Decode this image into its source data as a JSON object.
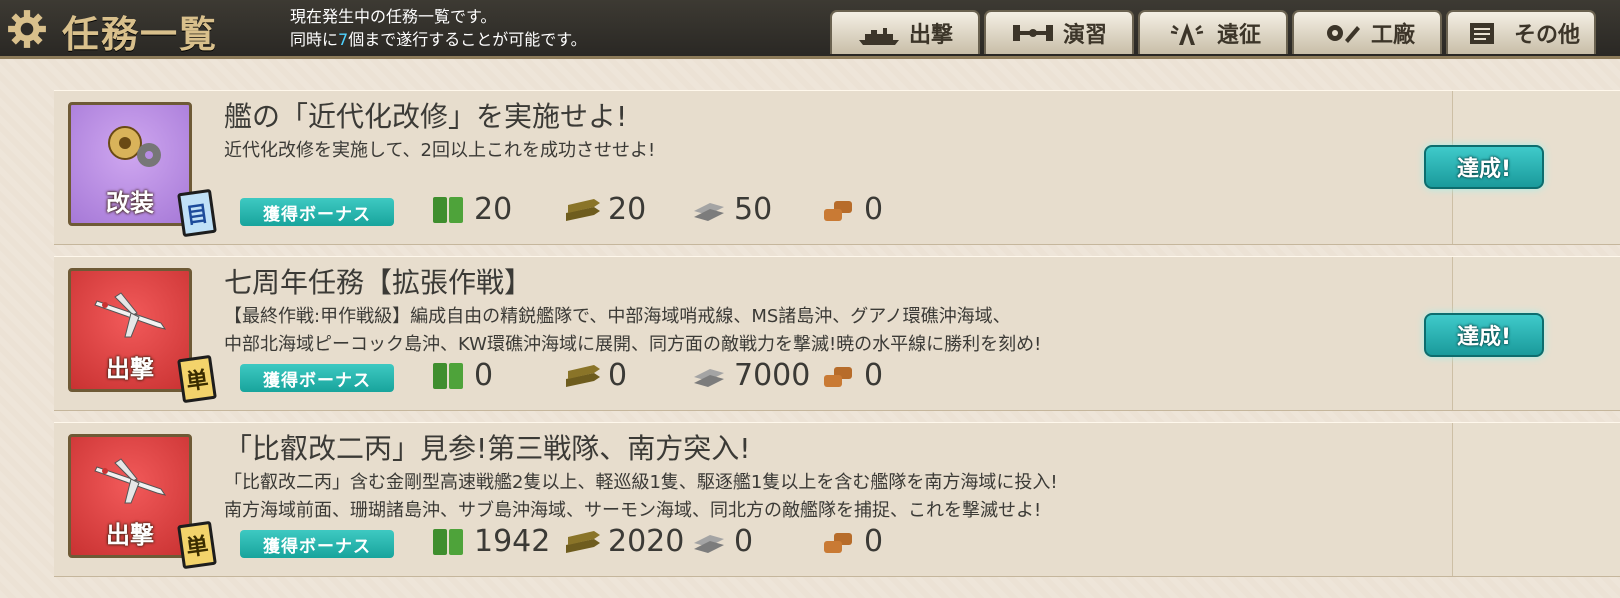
{
  "header": {
    "title": "任務一覧",
    "subtitle_line1": "現在発生中の任務一覧です。",
    "subtitle_line2_pre": "同時に",
    "subtitle_line2_num": "7",
    "subtitle_line2_post": "個まで遂行することが可能です。",
    "icon": "gear-icon"
  },
  "tabs": [
    {
      "label": "出撃",
      "icon": "battleship-silhouette-icon"
    },
    {
      "label": "演習",
      "icon": "dumbbell-icon"
    },
    {
      "label": "遠征",
      "icon": "radio-tower-icon"
    },
    {
      "label": "工廠",
      "icon": "wrench-gear-icon"
    },
    {
      "label": "その他",
      "icon": "notebook-icon"
    }
  ],
  "bonus_label": "獲得ボーナス",
  "achieved_label": "達成!",
  "resource_icons": [
    "fuel-icon",
    "ammo-icon",
    "steel-icon",
    "bauxite-icon"
  ],
  "quests": [
    {
      "category": "改装",
      "category_icon": "gears-icon",
      "frequency": "目",
      "title": "艦の「近代化改修」を実施せよ!",
      "desc_line1": "近代化改修を実施して、2回以上これを成功させせよ!",
      "desc_line2": "",
      "rewards": {
        "fuel": "20",
        "ammo": "20",
        "steel": "50",
        "bauxite": "0"
      },
      "achieved": true
    },
    {
      "category": "出撃",
      "category_icon": "plane-icon",
      "frequency": "単",
      "title": "七周年任務【拡張作戦】",
      "desc_line1": "【最終作戦:甲作戦級】編成自由の精鋭艦隊で、中部海域哨戒線、MS諸島沖、グアノ環礁沖海域、",
      "desc_line2": "中部北海域ピーコック島沖、KW環礁沖海域に展開、同方面の敵戦力を撃滅!暁の水平線に勝利を刻め!",
      "rewards": {
        "fuel": "0",
        "ammo": "0",
        "steel": "7000",
        "bauxite": "0"
      },
      "achieved": true
    },
    {
      "category": "出撃",
      "category_icon": "plane-icon",
      "frequency": "単",
      "title": "「比叡改二丙」見参!第三戦隊、南方突入!",
      "desc_line1": "「比叡改二丙」含む金剛型高速戦艦2隻以上、軽巡級1隻、駆逐艦1隻以上を含む艦隊を南方海域に投入!",
      "desc_line2": "南方海域前面、珊瑚諸島沖、サブ島沖海域、サーモン海域、同北方の敵艦隊を捕捉、これを撃滅せよ!",
      "rewards": {
        "fuel": "1942",
        "ammo": "2020",
        "steel": "0",
        "bauxite": "0"
      },
      "achieved": false
    }
  ]
}
